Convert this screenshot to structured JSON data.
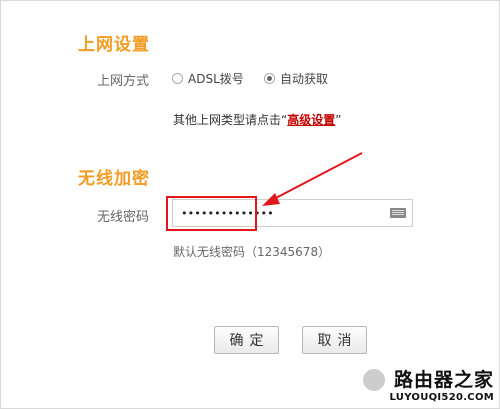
{
  "internet_section": {
    "title": "上网设置",
    "mode_label": "上网方式",
    "options": [
      {
        "label": "ADSL拨号",
        "checked": false
      },
      {
        "label": "自动获取",
        "checked": true
      }
    ],
    "hint_prefix": "其他上网类型请点击“",
    "hint_link": "高级设置",
    "hint_suffix": "”"
  },
  "wireless_section": {
    "title": "无线加密",
    "password_label": "无线密码",
    "password_value": "••••••••••••••",
    "default_password_note": "默认无线密码（12345678）"
  },
  "buttons": {
    "confirm": "确定",
    "cancel": "取消"
  },
  "watermark": {
    "logo": "路由器之家",
    "url": "LUYOUQI520.COM"
  },
  "colors": {
    "section_title": "#f39c24",
    "link": "#c40000",
    "highlight": "#e0181b"
  },
  "icons": {
    "keyboard": "keyboard-icon",
    "arrow": "red-arrow-annotation"
  }
}
